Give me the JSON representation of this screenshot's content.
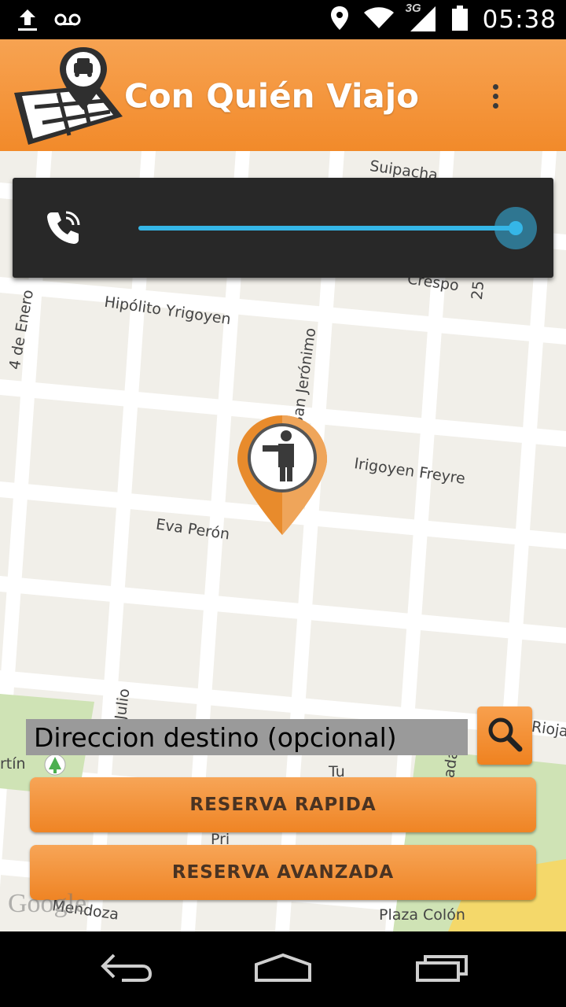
{
  "status_bar": {
    "time": "05:38",
    "network": "3G",
    "icons": [
      "upload-icon",
      "voicemail-icon",
      "location-icon",
      "wifi-icon",
      "signal-icon",
      "battery-icon"
    ]
  },
  "action_bar": {
    "title": "Con Quién Viajo",
    "logo": "map-taxi-logo",
    "overflow": "overflow-menu-icon"
  },
  "volume_dialog": {
    "icon": "phone-volume-icon",
    "level": 1.0,
    "accent_color": "#35b6e7"
  },
  "map": {
    "streets": [
      "Suipacha",
      "Crespo",
      "25",
      "4 de Enero",
      "Hipólito Yrigoyen",
      "San Jerónimo",
      "Irigoyen Freyre",
      "Eva Perón",
      "Julio",
      "rtín",
      "Tu",
      "ada",
      "Rioja",
      "Pri",
      "Mendoza",
      "Plaza Colón"
    ],
    "watermark": "Google",
    "pin_icon": "person-hailing-pin-icon"
  },
  "destination": {
    "placeholder": "Direccion destino (opcional)",
    "search_icon": "search-icon"
  },
  "buttons": {
    "quick": "RESERVA RAPIDA",
    "advanced": "RESERVA AVANZADA"
  },
  "nav_bar": {
    "back": "back-icon",
    "home": "home-icon",
    "recents": "recents-icon"
  },
  "colors": {
    "brand_orange": "#f28a2a",
    "map_bg": "#f1efe9"
  }
}
